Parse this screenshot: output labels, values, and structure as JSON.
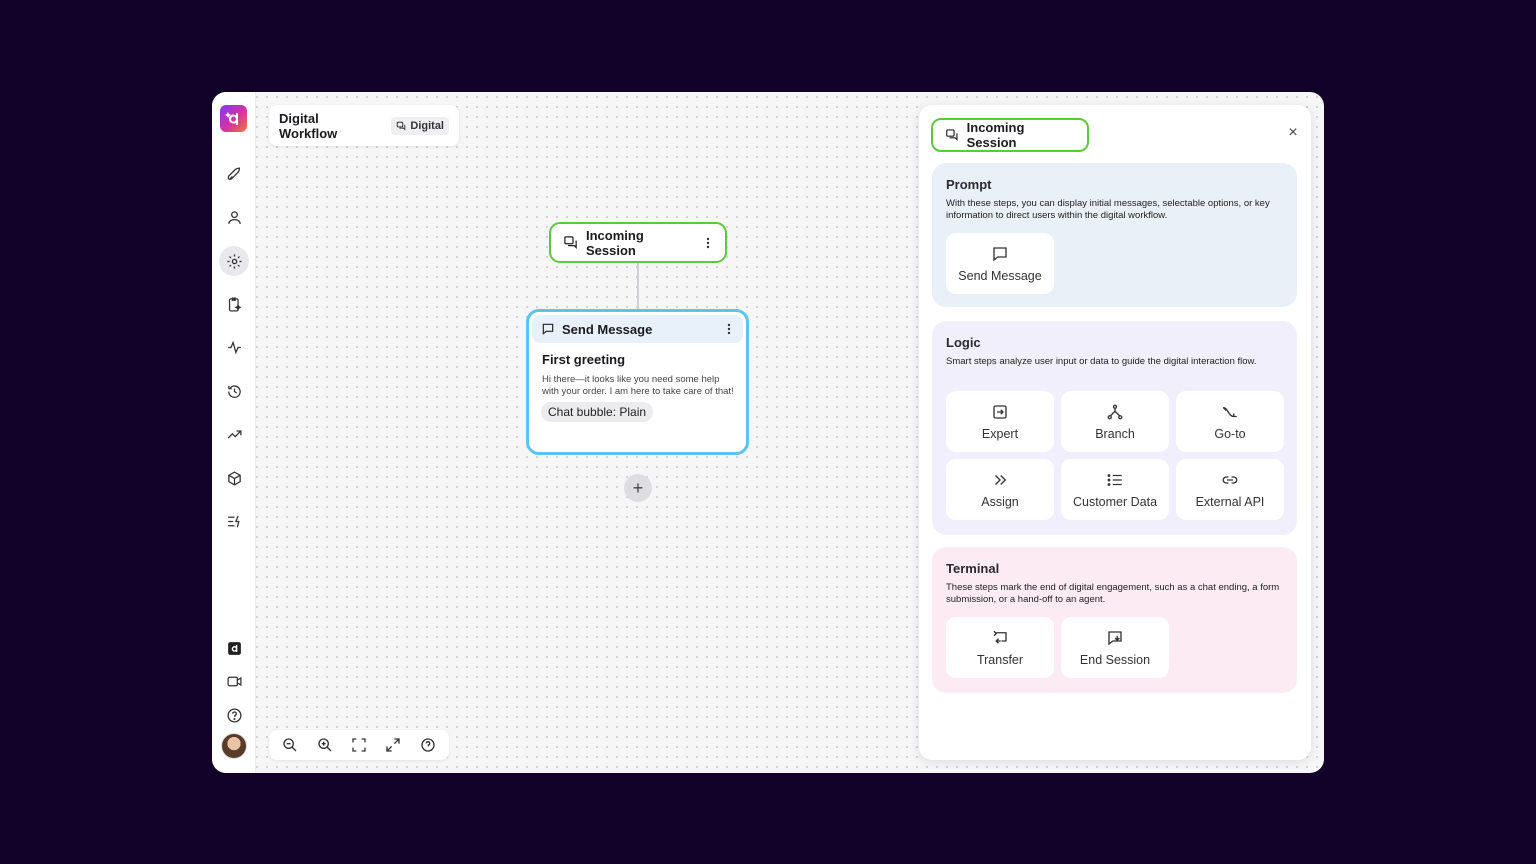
{
  "workflow": {
    "title": "Digital Workflow",
    "badge": "Digital"
  },
  "sidebar": {
    "items": [
      {
        "icon": "rocket-icon"
      },
      {
        "icon": "user-icon"
      },
      {
        "icon": "gear-icon",
        "active": true
      },
      {
        "icon": "clipboard-sparkle-icon"
      },
      {
        "icon": "activity-icon"
      },
      {
        "icon": "history-icon"
      },
      {
        "icon": "trending-up-icon"
      },
      {
        "icon": "cube-icon"
      },
      {
        "icon": "list-bolt-icon"
      }
    ],
    "bottom": [
      {
        "icon": "brand-icon"
      },
      {
        "icon": "video-icon"
      },
      {
        "icon": "help-icon"
      }
    ]
  },
  "canvas": {
    "incoming_node": {
      "label": "Incoming Session"
    },
    "send_node": {
      "header": "Send Message",
      "title": "First greeting",
      "body": "Hi there—it looks like you need some help with your order. I am here to take care of that!",
      "chip": "Chat bubble: Plain"
    }
  },
  "panel": {
    "title": "Incoming Session",
    "sections": {
      "prompt": {
        "title": "Prompt",
        "description": "With these steps, you can display initial messages, selectable options, or key information to direct users within the digital workflow.",
        "steps": [
          {
            "label": "Send Message",
            "icon": "message-icon"
          }
        ]
      },
      "logic": {
        "title": "Logic",
        "description": "Smart steps analyze user input or data to guide the digital interaction flow.",
        "steps": [
          {
            "label": "Expert",
            "icon": "expert-icon"
          },
          {
            "label": "Branch",
            "icon": "branch-icon"
          },
          {
            "label": "Go-to",
            "icon": "goto-icon"
          },
          {
            "label": "Assign",
            "icon": "assign-icon"
          },
          {
            "label": "Customer Data",
            "icon": "list-icon"
          },
          {
            "label": "External API",
            "icon": "link-icon"
          }
        ]
      },
      "terminal": {
        "title": "Terminal",
        "description": "These steps mark the end of digital engagement, such as a chat ending, a form submission, or a hand-off to an agent.",
        "steps": [
          {
            "label": "Transfer",
            "icon": "transfer-icon"
          },
          {
            "label": "End Session",
            "icon": "end-session-icon"
          }
        ]
      }
    }
  },
  "colors": {
    "background": "#12022a",
    "accent_green": "#5cc83a",
    "accent_blue": "#5cc4ee"
  }
}
